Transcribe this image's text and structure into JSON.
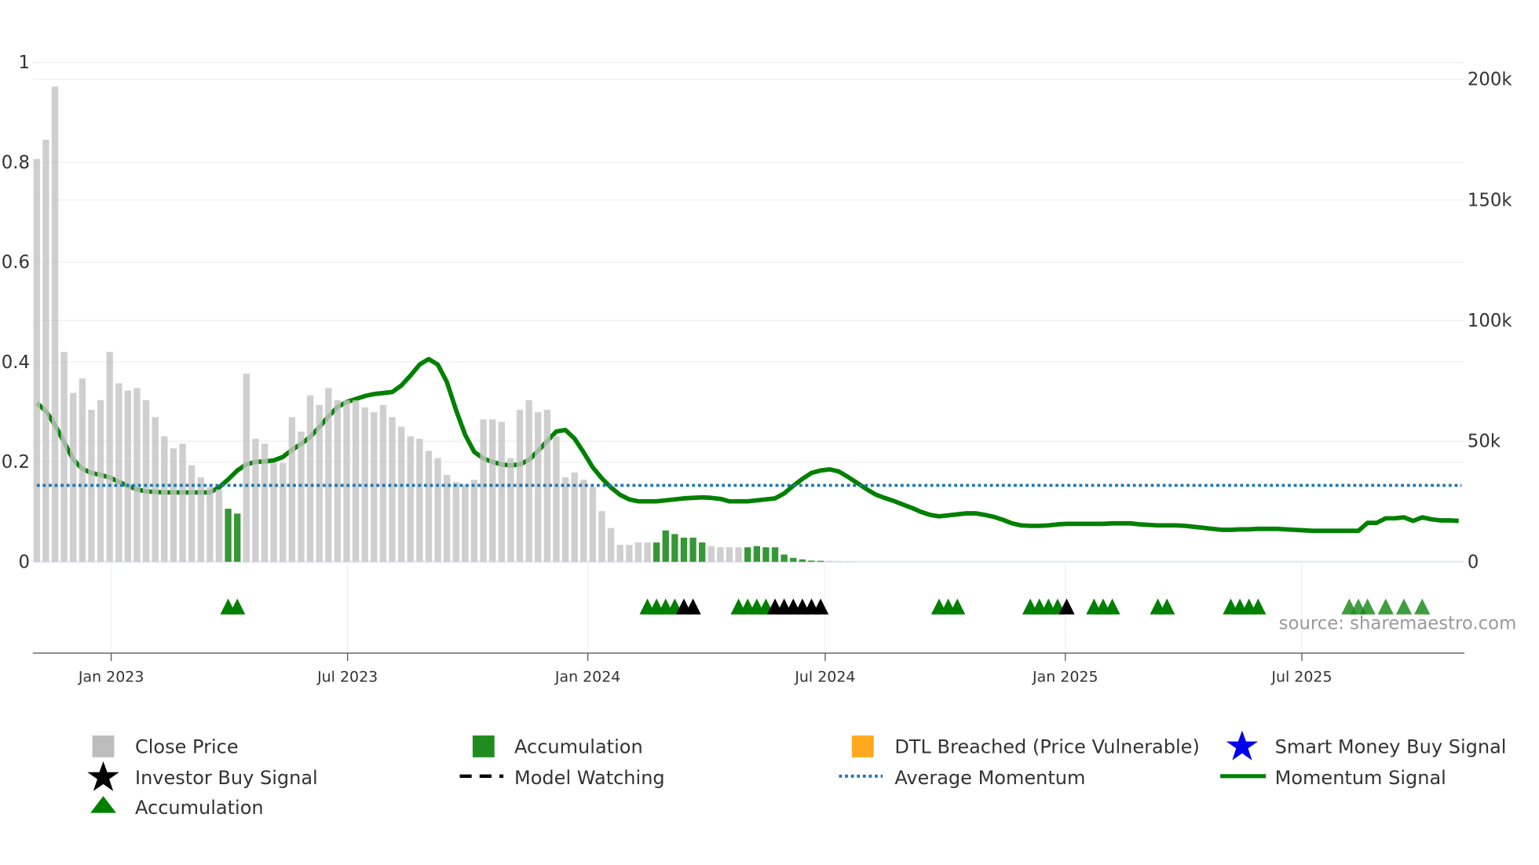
{
  "chart_data": {
    "type": "bar+line",
    "x_unit": "week index (weekly samples)",
    "x_ticks": [
      {
        "label": "Jan 2023",
        "week": 8.17
      },
      {
        "label": "Jul 2023",
        "week": 34.1
      },
      {
        "label": "Jan 2024",
        "week": 60.46
      },
      {
        "label": "Jul 2024",
        "week": 86.5
      },
      {
        "label": "Jan 2025",
        "week": 112.85
      },
      {
        "label": "Jul 2025",
        "week": 138.8
      }
    ],
    "left_axis": {
      "range": [
        0,
        1
      ],
      "ticks": [
        {
          "v": 0,
          "label": "0"
        },
        {
          "v": 0.2,
          "label": "0.2"
        },
        {
          "v": 0.4,
          "label": "0.4"
        },
        {
          "v": 0.6,
          "label": "0.6"
        },
        {
          "v": 0.8,
          "label": "0.8"
        },
        {
          "v": 1,
          "label": "1"
        }
      ]
    },
    "right_axis": {
      "range_k": [
        0,
        200
      ],
      "ticks": [
        {
          "v": 0,
          "label": "0"
        },
        {
          "v": 50,
          "label": "50k"
        },
        {
          "v": 100,
          "label": "100k"
        },
        {
          "v": 150,
          "label": "150k"
        },
        {
          "v": 200,
          "label": "200k"
        }
      ]
    },
    "close_price_k": [
      167,
      175,
      197,
      87,
      70,
      76,
      63,
      67,
      87,
      74,
      71,
      72,
      67,
      60,
      52,
      47,
      49,
      40,
      35,
      31,
      30,
      22,
      20,
      78,
      51,
      49,
      41,
      41,
      60,
      54,
      69,
      65,
      72,
      67,
      67,
      67,
      64,
      62,
      65,
      60,
      56,
      52,
      51,
      46,
      43,
      36,
      33,
      32,
      34,
      59,
      59,
      58,
      43,
      63,
      67,
      62,
      63,
      52,
      35,
      37,
      34,
      31,
      21,
      14,
      7,
      7,
      8,
      8,
      8,
      13,
      11.5,
      10,
      10,
      8,
      6.5,
      6,
      6,
      6,
      6,
      6.5,
      6,
      6,
      3,
      1.6,
      1,
      0.5,
      0.4,
      0.3,
      0.2,
      0.1
    ],
    "accumulation_bar_weeks": [
      21,
      22,
      68,
      69,
      70,
      71,
      72,
      73,
      78,
      79,
      80,
      81,
      82,
      83,
      84,
      85,
      86
    ],
    "momentum_signal": [
      0.318,
      0.302,
      0.274,
      0.24,
      0.205,
      0.186,
      0.178,
      0.174,
      0.169,
      0.16,
      0.152,
      0.145,
      0.141,
      0.14,
      0.139,
      0.139,
      0.139,
      0.139,
      0.139,
      0.139,
      0.149,
      0.165,
      0.183,
      0.195,
      0.2,
      0.201,
      0.203,
      0.21,
      0.224,
      0.236,
      0.25,
      0.27,
      0.291,
      0.31,
      0.32,
      0.326,
      0.332,
      0.336,
      0.338,
      0.34,
      0.353,
      0.373,
      0.395,
      0.406,
      0.395,
      0.36,
      0.304,
      0.254,
      0.22,
      0.207,
      0.2,
      0.195,
      0.193,
      0.195,
      0.204,
      0.222,
      0.242,
      0.261,
      0.264,
      0.247,
      0.219,
      0.189,
      0.167,
      0.149,
      0.134,
      0.125,
      0.121,
      0.121,
      0.121,
      0.123,
      0.125,
      0.127,
      0.128,
      0.129,
      0.128,
      0.126,
      0.121,
      0.121,
      0.121,
      0.123,
      0.125,
      0.127,
      0.137,
      0.152,
      0.166,
      0.178,
      0.183,
      0.185,
      0.181,
      0.17,
      0.158,
      0.146,
      0.135,
      0.128,
      0.122,
      0.115,
      0.108,
      0.1,
      0.094,
      0.091,
      0.093,
      0.095,
      0.097,
      0.097,
      0.094,
      0.09,
      0.084,
      0.077,
      0.073,
      0.072,
      0.072,
      0.073,
      0.075,
      0.076,
      0.076,
      0.076,
      0.076,
      0.076,
      0.077,
      0.077,
      0.077,
      0.075,
      0.074,
      0.073,
      0.073,
      0.073,
      0.072,
      0.07,
      0.068,
      0.066,
      0.064,
      0.064,
      0.065,
      0.065,
      0.066,
      0.066,
      0.066,
      0.065,
      0.064,
      0.063,
      0.062,
      0.062,
      0.062,
      0.062,
      0.062,
      0.062,
      0.078,
      0.078,
      0.087,
      0.087,
      0.089,
      0.082,
      0.089,
      0.085,
      0.083,
      0.083,
      0.082
    ],
    "average_momentum": 0.153,
    "accumulation_markers": [
      21,
      22,
      67,
      68,
      69,
      70,
      77,
      78,
      79,
      80,
      99,
      100,
      101,
      109,
      110,
      111,
      112,
      116,
      117,
      118,
      123,
      124,
      131,
      132,
      133,
      134
    ],
    "accumulation_markers_faded": [
      144,
      145,
      146,
      148,
      150,
      152
    ],
    "investor_buy_markers": [
      71,
      72,
      81,
      82,
      83,
      84,
      85,
      86,
      113
    ],
    "colors": {
      "close": "#c4c4c4",
      "accumulation": "#1f8c1f",
      "momentum": "#008000",
      "average": "#1f77b4",
      "dtl": "#ffa91f",
      "smart_money": "#0000ee",
      "investor": "#000000"
    }
  },
  "source": "source: sharemaestro.com",
  "legend": [
    {
      "label": "Close Price",
      "icon": "gray-square"
    },
    {
      "label": "Accumulation",
      "icon": "green-square"
    },
    {
      "label": "DTL Breached (Price Vulnerable)",
      "icon": "orange-square"
    },
    {
      "label": "Smart Money Buy Signal",
      "icon": "blue-star"
    },
    {
      "label": "Investor Buy Signal",
      "icon": "black-star"
    },
    {
      "label": "Model Watching",
      "icon": "black-dash"
    },
    {
      "label": "Average Momentum",
      "icon": "blue-dotted"
    },
    {
      "label": "Momentum Signal",
      "icon": "green-line"
    },
    {
      "label": "Accumulation",
      "icon": "green-triangle"
    }
  ]
}
